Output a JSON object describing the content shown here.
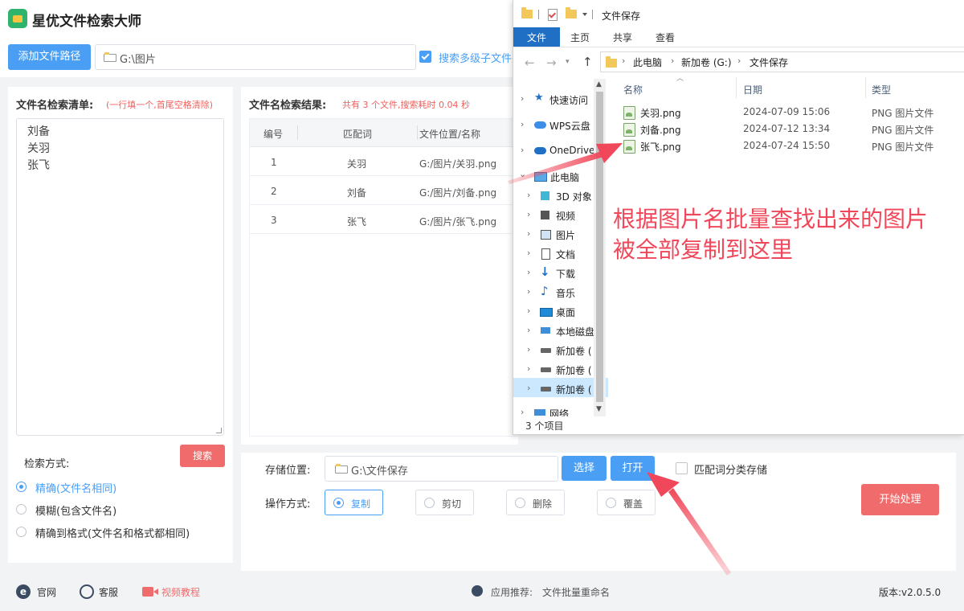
{
  "app": {
    "title": "星优文件检索大师",
    "add_path_button": "添加文件路径",
    "path_value": "G:\\图片",
    "search_subfolders_label": "搜索多级子文件夹",
    "search_subfolders_checked": true
  },
  "search_list": {
    "label": "文件名检索清单:",
    "hint": "(一行填一个,首尾空格清除)",
    "names": "刘备\n关羽\n张飞",
    "search_button": "搜索"
  },
  "search_mode": {
    "label": "检索方式:",
    "options": [
      {
        "label": "精确(文件名相同)",
        "selected": true
      },
      {
        "label": "模糊(包含文件名)",
        "selected": false
      },
      {
        "label": "精确到格式(文件名和格式都相同)",
        "selected": false
      }
    ]
  },
  "results": {
    "label": "文件名检索结果:",
    "summary": "共有 3 个文件,搜索耗时 0.04 秒",
    "columns": [
      "编号",
      "匹配词",
      "文件位置/名称"
    ],
    "rows": [
      {
        "no": "1",
        "word": "关羽",
        "path": "G:/图片/关羽.png"
      },
      {
        "no": "2",
        "word": "刘备",
        "path": "G:/图片/刘备.png"
      },
      {
        "no": "3",
        "word": "张飞",
        "path": "G:/图片/张飞.png"
      }
    ]
  },
  "storage": {
    "label": "存储位置:",
    "path": "G:\\文件保存",
    "choose_button": "选择",
    "open_button": "打开",
    "classify_label": "匹配词分类存储",
    "classify_checked": false
  },
  "operation": {
    "label": "操作方式:",
    "options": [
      {
        "label": "复制",
        "selected": true
      },
      {
        "label": "剪切",
        "selected": false
      },
      {
        "label": "删除",
        "selected": false
      },
      {
        "label": "覆盖",
        "selected": false
      }
    ],
    "start_button": "开始处理"
  },
  "footer": {
    "website": "官网",
    "service": "客服",
    "video": "视频教程",
    "recommend_label": "应用推荐:",
    "recommend_app": "文件批量重命名",
    "version": "版本:v2.0.5.0"
  },
  "explorer": {
    "title": "文件保存",
    "ribbon_tabs": [
      "文件",
      "主页",
      "共享",
      "查看"
    ],
    "breadcrumb": [
      "此电脑",
      "新加卷 (G:)",
      "文件保存"
    ],
    "nav_items": [
      "快速访问",
      "WPS云盘",
      "OneDrive",
      "此电脑",
      "3D 对象",
      "视频",
      "图片",
      "文档",
      "下载",
      "音乐",
      "桌面",
      "本地磁盘",
      "新加卷 (",
      "新加卷 (",
      "新加卷 (",
      "网络"
    ],
    "columns": [
      "名称",
      "日期",
      "类型"
    ],
    "files": [
      {
        "name": "关羽.png",
        "date": "2024-07-09 15:06",
        "type": "PNG 图片文件"
      },
      {
        "name": "刘备.png",
        "date": "2024-07-12 13:34",
        "type": "PNG 图片文件"
      },
      {
        "name": "张飞.png",
        "date": "2024-07-24 15:50",
        "type": "PNG 图片文件"
      }
    ],
    "status": "3 个项目"
  },
  "annotation": {
    "line1": "根据图片名批量查找出来的图片",
    "line2": "被全部复制到这里"
  },
  "colors": {
    "accent": "#4a9ff5",
    "danger": "#f06c6c",
    "annotation": "#f0485a",
    "brand_green": "#2fb46e"
  }
}
